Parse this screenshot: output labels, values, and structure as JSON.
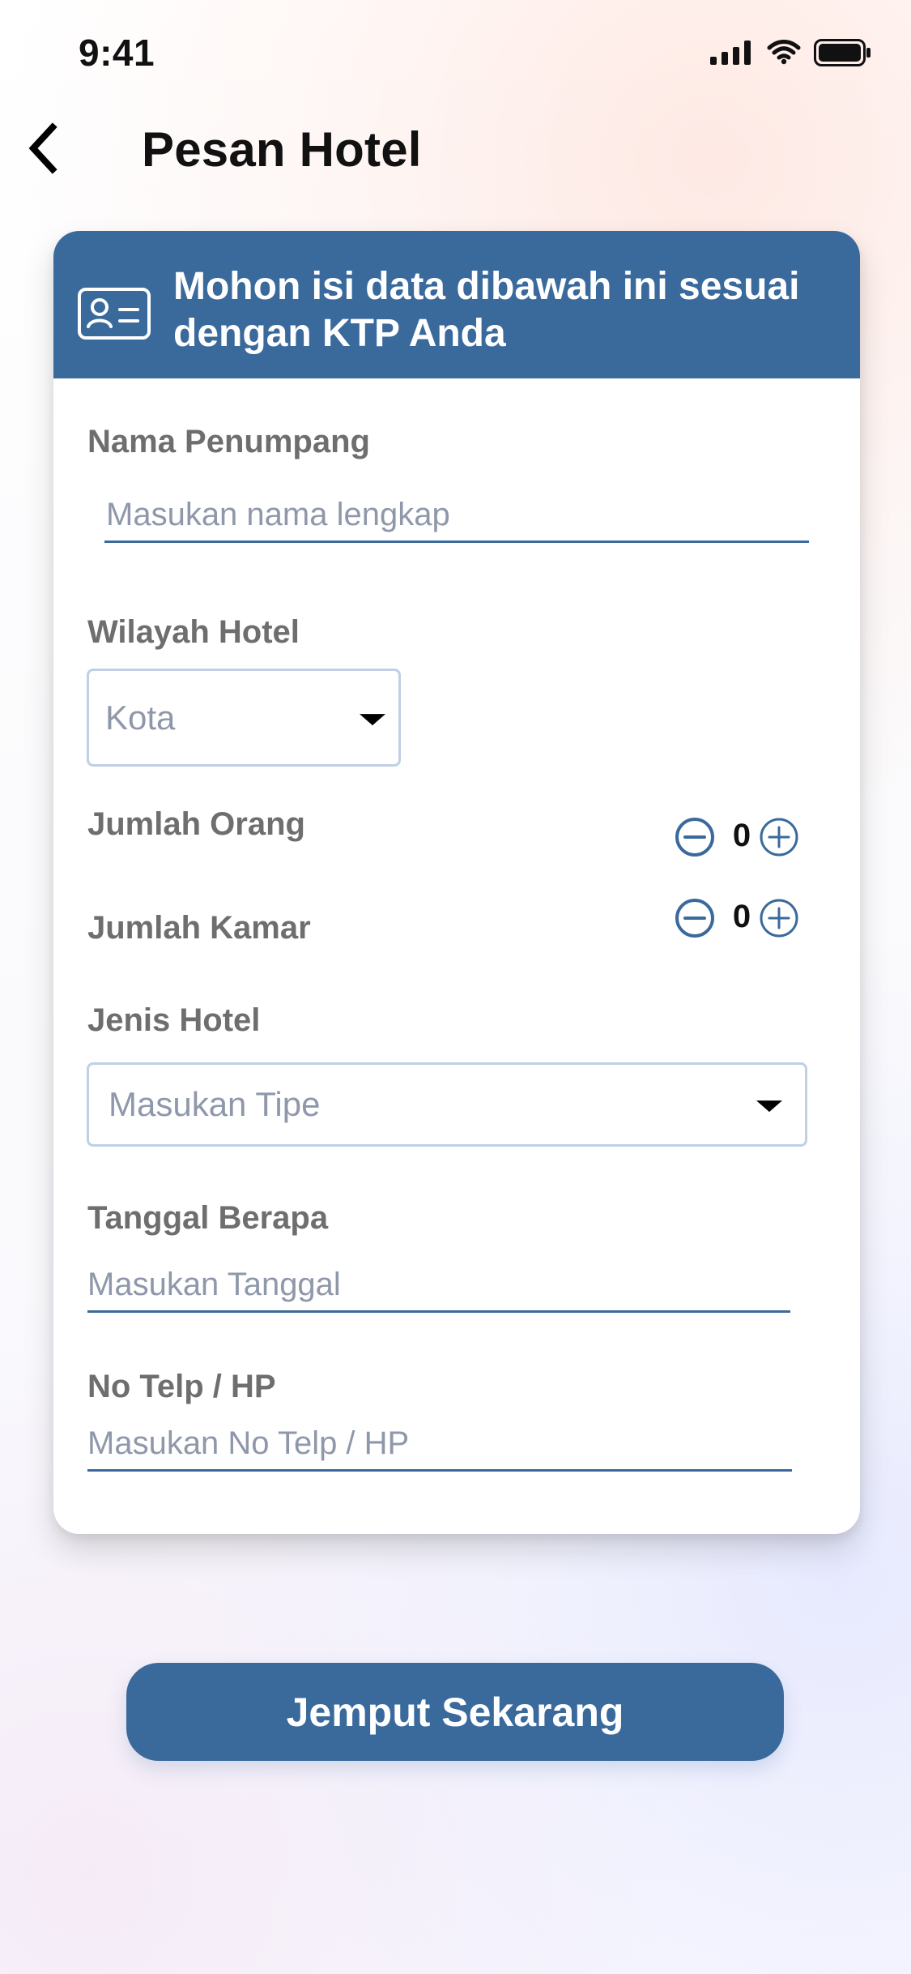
{
  "status_bar": {
    "time": "9:41",
    "icons": [
      "signal-icon",
      "wifi-icon",
      "battery-icon"
    ]
  },
  "header": {
    "title": "Pesan Hotel",
    "back_icon": "chevron-left-icon"
  },
  "form_card": {
    "banner_text": "Mohon isi data dibawah ini sesuai dengan KTP Anda",
    "banner_icon": "id-card-icon",
    "fields": {
      "nama_penumpang": {
        "label": "Nama Penumpang",
        "placeholder": "Masukan nama lengkap",
        "value": ""
      },
      "wilayah_hotel": {
        "label": "Wilayah Hotel",
        "selected": "Kota"
      },
      "jumlah_orang": {
        "label": "Jumlah Orang",
        "value": "0"
      },
      "jumlah_kamar": {
        "label": "Jumlah Kamar",
        "value": "0"
      },
      "jenis_hotel": {
        "label": "Jenis Hotel",
        "selected": "Masukan Tipe"
      },
      "tanggal_berapa": {
        "label": "Tanggal Berapa",
        "placeholder": "Masukan Tanggal",
        "value": ""
      },
      "no_telp": {
        "label": "No Telp / HP",
        "placeholder": "Masukan No Telp / HP",
        "value": ""
      }
    }
  },
  "actions": {
    "submit_label": "Jemput Sekarang"
  },
  "colors": {
    "primary": "#3A6A9C",
    "label_gray": "#6E6E6E",
    "placeholder_gray": "#8F98AA"
  }
}
